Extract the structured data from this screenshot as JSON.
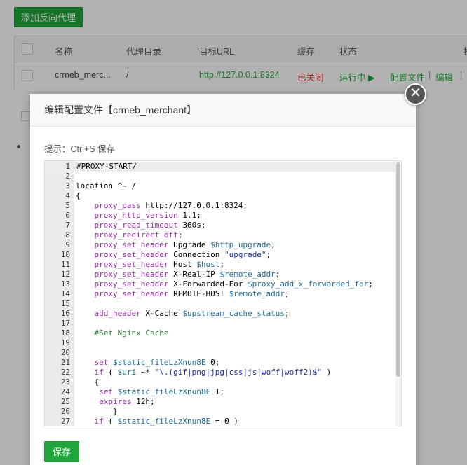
{
  "background": {
    "add_button": "添加反向代理",
    "table": {
      "headers": [
        "名称",
        "代理目录",
        "目标URL",
        "缓存",
        "状态",
        "操"
      ],
      "row": {
        "name": "crmeb_merc...",
        "dir": "/",
        "url": "http://127.0.0.1:8324",
        "cache": "已关闭",
        "status": "运行中 ▶",
        "action_config": "配置文件",
        "action_sep": "|",
        "action_edit": "编辑",
        "action_sep2": "|"
      }
    }
  },
  "colors": {
    "accent": "#20a53a",
    "danger": "#e0201d",
    "url": "#20a53a"
  },
  "dialog": {
    "title": "编辑配置文件【crmeb_merchant】",
    "close_icon": "close-icon",
    "tip": "提示：Ctrl+S 保存",
    "save_button": "保存"
  },
  "editor": {
    "lines": [
      {
        "n": "1",
        "tokens": [
          [
            "plain",
            "#PROXY-START/"
          ]
        ]
      },
      {
        "n": "2",
        "tokens": []
      },
      {
        "n": "3",
        "tokens": [
          [
            "plain",
            "location ^~ /"
          ]
        ]
      },
      {
        "n": "4",
        "tokens": [
          [
            "plain",
            "{"
          ]
        ]
      },
      {
        "n": "5",
        "tokens": [
          [
            "plain",
            "    "
          ],
          [
            "kw",
            "proxy_pass"
          ],
          [
            "plain",
            " http://127.0.0.1:8324;"
          ]
        ]
      },
      {
        "n": "6",
        "tokens": [
          [
            "plain",
            "    "
          ],
          [
            "kw",
            "proxy_http_version"
          ],
          [
            "plain",
            " 1.1;"
          ]
        ]
      },
      {
        "n": "7",
        "tokens": [
          [
            "plain",
            "    "
          ],
          [
            "kw",
            "proxy_read_timeout"
          ],
          [
            "plain",
            " 360s;"
          ]
        ]
      },
      {
        "n": "8",
        "tokens": [
          [
            "plain",
            "    "
          ],
          [
            "kw",
            "proxy_redirect"
          ],
          [
            "plain",
            " "
          ],
          [
            "kw",
            "off"
          ],
          [
            "plain",
            ";"
          ]
        ]
      },
      {
        "n": "9",
        "tokens": [
          [
            "plain",
            "    "
          ],
          [
            "kw",
            "proxy_set_header"
          ],
          [
            "plain",
            " Upgrade "
          ],
          [
            "var",
            "$http_upgrade"
          ],
          [
            "plain",
            ";"
          ]
        ]
      },
      {
        "n": "10",
        "tokens": [
          [
            "plain",
            "    "
          ],
          [
            "kw",
            "proxy_set_header"
          ],
          [
            "plain",
            " Connection "
          ],
          [
            "str",
            "\"upgrade\""
          ],
          [
            "plain",
            ";"
          ]
        ]
      },
      {
        "n": "11",
        "tokens": [
          [
            "plain",
            "    "
          ],
          [
            "kw",
            "proxy_set_header"
          ],
          [
            "plain",
            " Host "
          ],
          [
            "var",
            "$host"
          ],
          [
            "plain",
            ";"
          ]
        ]
      },
      {
        "n": "12",
        "tokens": [
          [
            "plain",
            "    "
          ],
          [
            "kw",
            "proxy_set_header"
          ],
          [
            "plain",
            " X-Real-IP "
          ],
          [
            "var",
            "$remote_addr"
          ],
          [
            "plain",
            ";"
          ]
        ]
      },
      {
        "n": "13",
        "tokens": [
          [
            "plain",
            "    "
          ],
          [
            "kw",
            "proxy_set_header"
          ],
          [
            "plain",
            " X-Forwarded-For "
          ],
          [
            "var",
            "$proxy_add_x_forwarded_for"
          ],
          [
            "plain",
            ";"
          ]
        ]
      },
      {
        "n": "14",
        "tokens": [
          [
            "plain",
            "    "
          ],
          [
            "kw",
            "proxy_set_header"
          ],
          [
            "plain",
            " REMOTE-HOST "
          ],
          [
            "var",
            "$remote_addr"
          ],
          [
            "plain",
            ";"
          ]
        ]
      },
      {
        "n": "15",
        "tokens": []
      },
      {
        "n": "16",
        "tokens": [
          [
            "plain",
            "    "
          ],
          [
            "kw",
            "add_header"
          ],
          [
            "plain",
            " X-Cache "
          ],
          [
            "var",
            "$upstream_cache_status"
          ],
          [
            "plain",
            ";"
          ]
        ]
      },
      {
        "n": "17",
        "tokens": []
      },
      {
        "n": "18",
        "tokens": [
          [
            "plain",
            "    "
          ],
          [
            "cmt",
            "#Set Nginx Cache"
          ]
        ]
      },
      {
        "n": "19",
        "tokens": []
      },
      {
        "n": "20",
        "tokens": []
      },
      {
        "n": "21",
        "tokens": [
          [
            "plain",
            "    "
          ],
          [
            "kw",
            "set"
          ],
          [
            "plain",
            " "
          ],
          [
            "var",
            "$static_fileLzXnun8E"
          ],
          [
            "plain",
            " 0;"
          ]
        ]
      },
      {
        "n": "22",
        "tokens": [
          [
            "plain",
            "    "
          ],
          [
            "kw",
            "if"
          ],
          [
            "plain",
            " ( "
          ],
          [
            "var",
            "$uri"
          ],
          [
            "plain",
            " ~* "
          ],
          [
            "str",
            "\"\\.(gif|png|jpg|css|js|woff|woff2)$\""
          ],
          [
            "plain",
            " )"
          ]
        ]
      },
      {
        "n": "23",
        "tokens": [
          [
            "plain",
            "    {"
          ]
        ]
      },
      {
        "n": "24",
        "tokens": [
          [
            "plain",
            "     "
          ],
          [
            "kw",
            "set"
          ],
          [
            "plain",
            " "
          ],
          [
            "var",
            "$static_fileLzXnun8E"
          ],
          [
            "plain",
            " 1;"
          ]
        ]
      },
      {
        "n": "25",
        "tokens": [
          [
            "plain",
            "     "
          ],
          [
            "kw",
            "expires"
          ],
          [
            "plain",
            " 12h;"
          ]
        ]
      },
      {
        "n": "26",
        "tokens": [
          [
            "plain",
            "        }"
          ]
        ]
      },
      {
        "n": "27",
        "tokens": [
          [
            "plain",
            "    "
          ],
          [
            "kw",
            "if"
          ],
          [
            "plain",
            " ( "
          ],
          [
            "var",
            "$static_fileLzXnun8E"
          ],
          [
            "plain",
            " = 0 )"
          ]
        ]
      }
    ]
  }
}
